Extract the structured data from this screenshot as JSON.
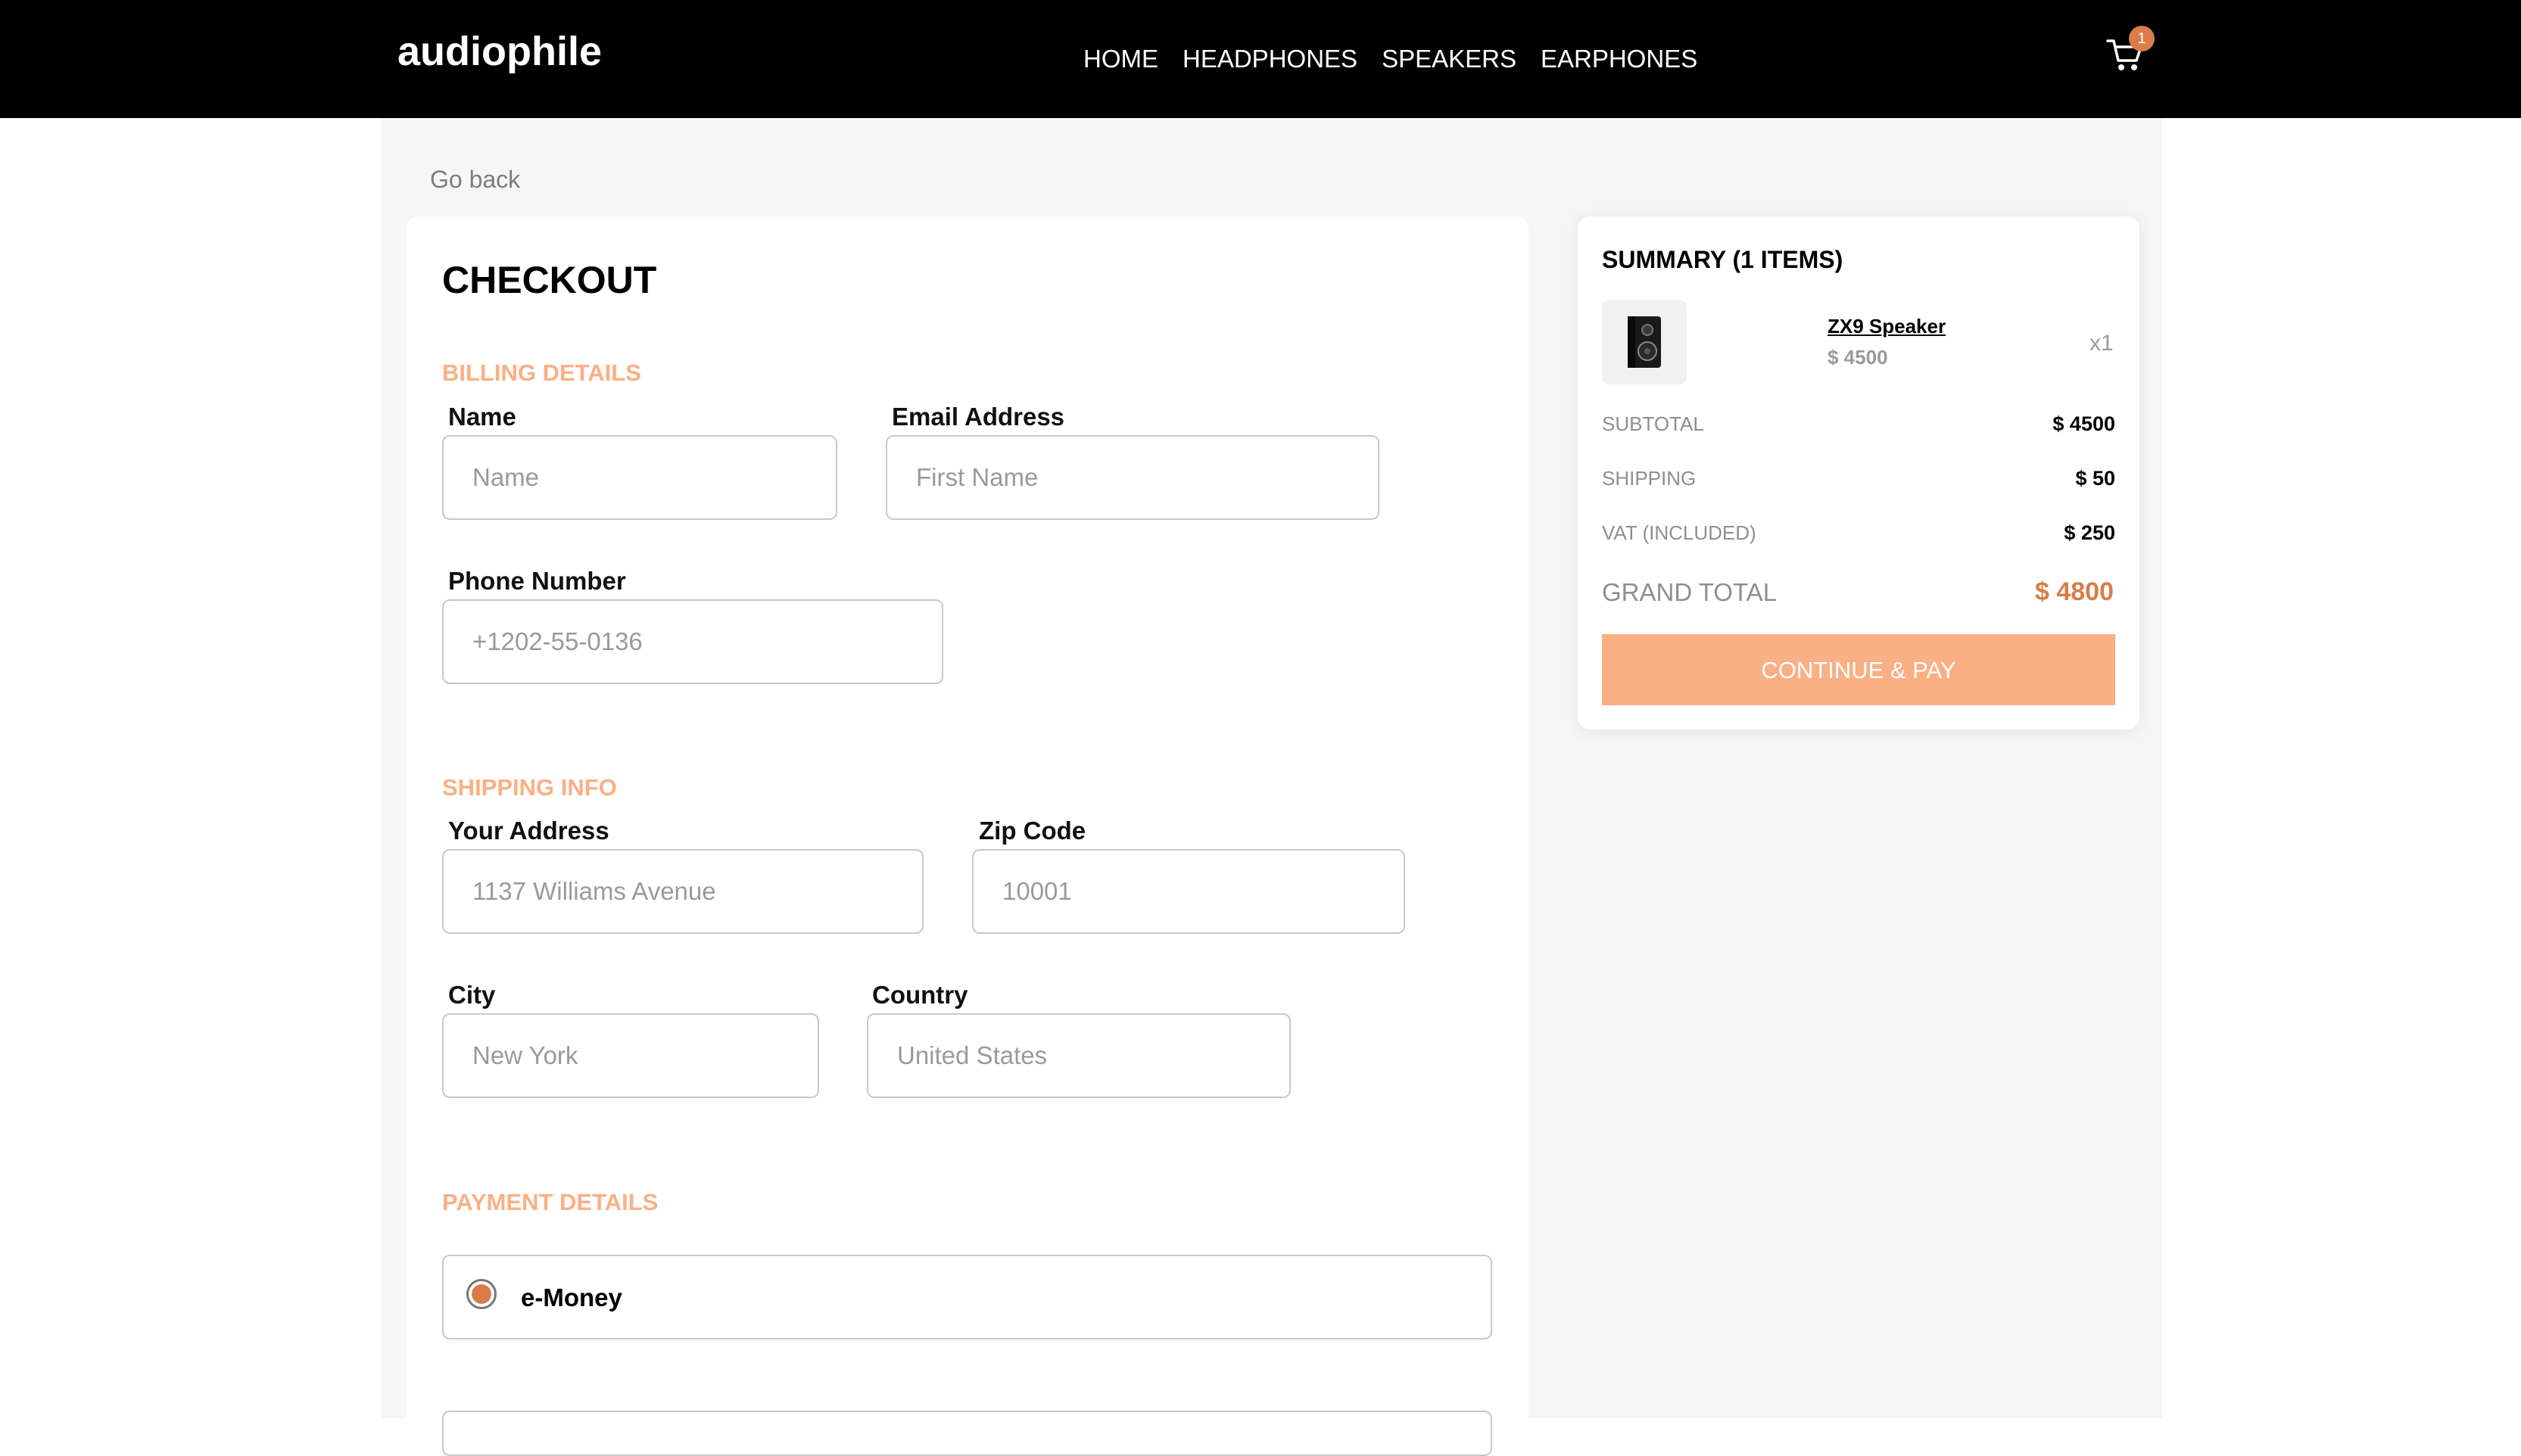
{
  "header": {
    "logo": "audiophile",
    "nav": [
      "HOME",
      "HEADPHONES",
      "SPEAKERS",
      "EARPHONES"
    ],
    "cart_count": "1",
    "cart_icon": "cart-icon"
  },
  "go_back": "Go back",
  "checkout": {
    "title": "CHECKOUT",
    "billing": {
      "heading": "BILLING DETAILS",
      "name_label": "Name",
      "name_placeholder": "Name",
      "email_label": "Email Address",
      "email_placeholder": "First Name",
      "phone_label": "Phone Number",
      "phone_placeholder": "+1202-55-0136"
    },
    "shipping": {
      "heading": "SHIPPING INFO",
      "address_label": "Your Address",
      "address_placeholder": "1137 Williams Avenue",
      "zip_label": "Zip Code",
      "zip_placeholder": "10001",
      "city_label": "City",
      "city_placeholder": "New York",
      "country_label": "Country",
      "country_placeholder": "United States"
    },
    "payment": {
      "heading": "PAYMENT DETAILS",
      "option_emoney": "e-Money"
    }
  },
  "summary": {
    "title": "SUMMARY (1 ITEMS)",
    "item": {
      "name": "ZX9 Speaker",
      "price": "$ 4500",
      "qty": "x1",
      "icon": "speaker-icon"
    },
    "subtotal_label": "SUBTOTAL",
    "subtotal": "$ 4500",
    "shipping_label": "SHIPPING",
    "shipping": "$ 50",
    "vat_label": "VAT (INCLUDED)",
    "vat": "$ 250",
    "grand_total_label": "GRAND TOTAL",
    "grand_total": "$ 4800",
    "pay_button": "CONTINUE & PAY"
  },
  "colors": {
    "accent": "#d87d4a",
    "accent_light": "#fbaf85",
    "header_bg": "#000000"
  }
}
